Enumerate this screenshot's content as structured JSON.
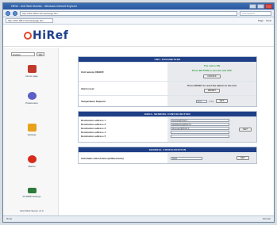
{
  "browser": {
    "title": "HiRef - Unit Web Monitor - Windows Internet Explorer",
    "url": "http://192.168.0.10/mainpage.htm",
    "search_placeholder": "Live Search",
    "tab_label": "http://192.168.0.10/mainpage.htm",
    "tools": [
      "Page",
      "Tools"
    ],
    "status_left": "Done",
    "status_right": "Internet"
  },
  "brand": {
    "name": "HiRef"
  },
  "left_nav": {
    "language_value": "English",
    "language_go": "OK",
    "items": [
      {
        "label": "Home page",
        "icon": "home-icon",
        "color": "#c0392b"
      },
      {
        "label": "Parameters",
        "icon": "gears-icon",
        "color": "#5b5fc7"
      },
      {
        "label": "Settings",
        "icon": "settings-icon",
        "color": "#e6a21a"
      },
      {
        "label": "Alarms",
        "icon": "alarm-icon",
        "color": "#d72c1c"
      },
      {
        "label": "PCWEB Settings",
        "icon": "network-card-icon",
        "color": "#2f7a3b"
      }
    ],
    "footer": "Hiref Web Server v1.0"
  },
  "sections": {
    "unit": {
      "title": "UNIT PARAMETERS",
      "onoff_label": "Unit remote ON/OFF",
      "onoff_status": "The unit is ON",
      "onoff_note": "Press BUTTON to turn the unit OFF",
      "onoff_button": "ON/OFF",
      "reset_label": "Alarm reset",
      "reset_note": "Press RESET to reset the alarms in the unit",
      "reset_button": "RESET",
      "setpoint_label": "Temperature Setpoint",
      "setpoint_value": "22.0",
      "setpoint_unit": "[°C]",
      "setpoint_button": "SET"
    },
    "email": {
      "title": "EMAIL SENDING CONFIGURATION",
      "labels": [
        "Destination address 1",
        "Destination address 2",
        "Destination address 3",
        "Destination address 4",
        "Destination address 5"
      ],
      "values": [
        "service@hiref.it",
        "assistance@hiref.it",
        "test.user@hiref.it",
        "",
        ""
      ],
      "button": "SET"
    },
    "general": {
      "title": "GENERAL CONFIGURATION",
      "refresh_label": "Automatic refresh time (milliseconds)",
      "refresh_value": "5000",
      "button": "SET"
    }
  }
}
